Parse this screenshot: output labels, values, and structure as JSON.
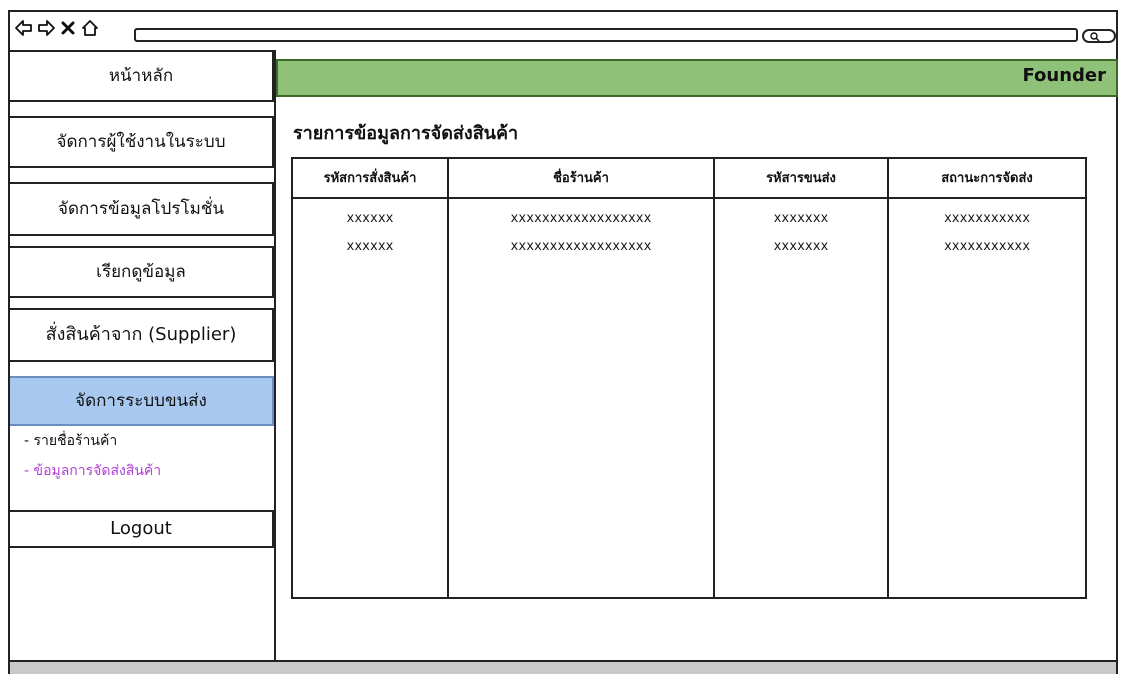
{
  "browser": {
    "icons": [
      "back-arrow-icon",
      "forward-arrow-icon",
      "close-icon",
      "home-icon",
      "search-icon"
    ]
  },
  "header": {
    "brand": "Founder",
    "accent_color": "#8fc178"
  },
  "sidebar": {
    "items": [
      {
        "label": "หน้าหลัก"
      },
      {
        "label": "จัดการผู้ใช้งานในระบบ"
      },
      {
        "label": "จัดการข้อมูลโปรโมชั่น"
      },
      {
        "label": "เรียกดูข้อมูล"
      },
      {
        "label": "สั่งสินค้าจาก (Supplier)"
      },
      {
        "label": "จัดการระบบขนส่ง",
        "active": true
      }
    ],
    "sub_items": [
      {
        "label": "- รายชื่อร้านค้า"
      },
      {
        "label": "- ข้อมูลการจัดส่งสินค้า",
        "highlight": true
      }
    ],
    "logout_label": "Logout",
    "active_color": "#a8c8ef",
    "highlight_color": "#b140d8"
  },
  "main": {
    "title": "รายการข้อมูลการจัดส่งสินค้า",
    "table": {
      "headers": [
        "รหัสการสั่งสินค้า",
        "ชื่อร้านค้า",
        "รหัสารขนส่ง",
        "สถานะการจัดส่ง"
      ],
      "rows": [
        [
          "xxxxxx",
          "xxxxxxxxxxxxxxxxxx",
          "xxxxxxx",
          "xxxxxxxxxxx"
        ],
        [
          "xxxxxx",
          "xxxxxxxxxxxxxxxxxx",
          "xxxxxxx",
          "xxxxxxxxxxx"
        ]
      ]
    }
  }
}
